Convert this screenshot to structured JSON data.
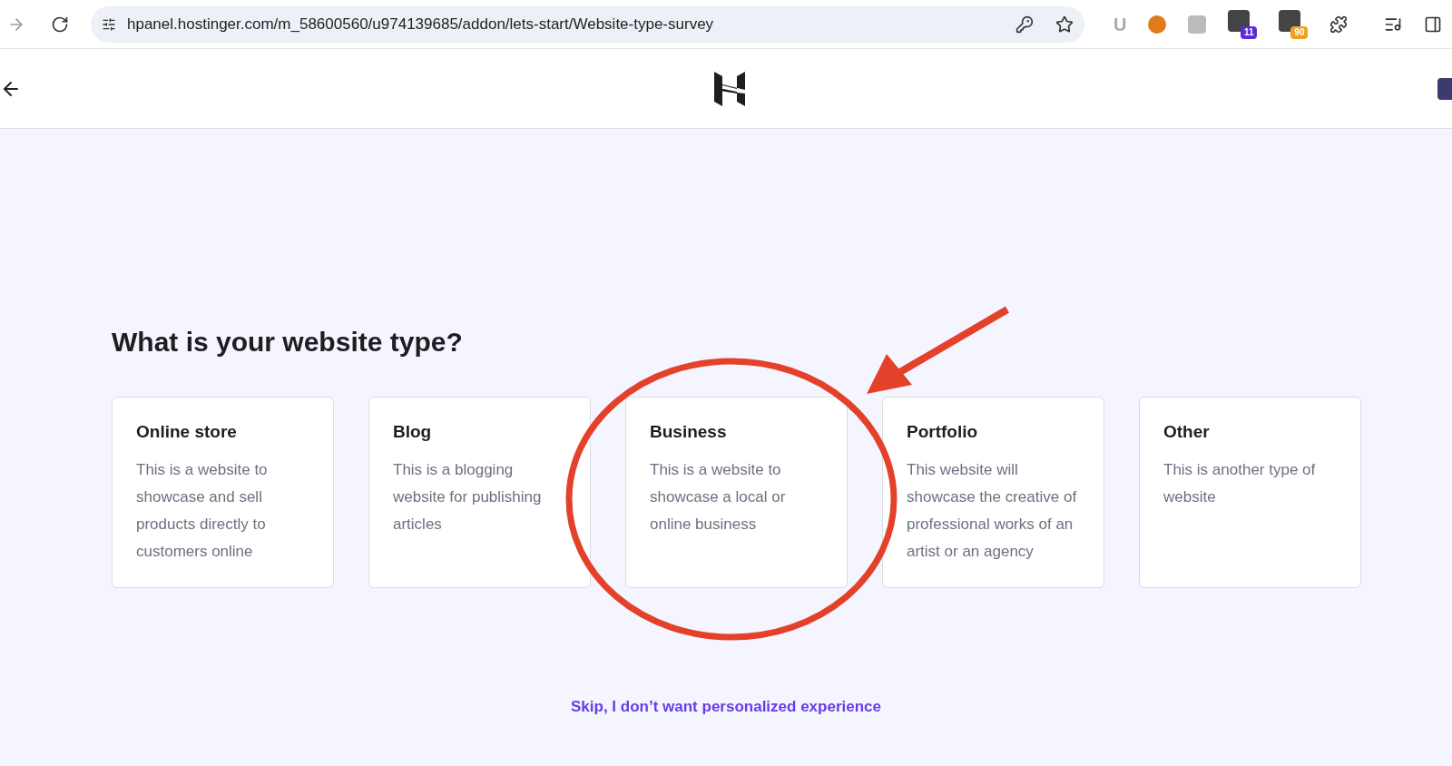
{
  "browser": {
    "url": "hpanel.hostinger.com/m_58600560/u974139685/addon/lets-start/Website-type-survey",
    "extensions": [
      {
        "kind": "letter",
        "label": "U"
      },
      {
        "kind": "plain"
      },
      {
        "kind": "plain"
      },
      {
        "kind": "badge",
        "badge": "11",
        "color": "#5b2bd6"
      },
      {
        "kind": "badge",
        "badge": "90",
        "color": "#f0a020"
      }
    ]
  },
  "page": {
    "heading": "What is your website type?",
    "options": [
      {
        "title": "Online store",
        "description": "This is a website to showcase and sell products directly to customers online"
      },
      {
        "title": "Blog",
        "description": "This is a blogging website for publishing articles"
      },
      {
        "title": "Business",
        "description": "This is a website to showcase a local or online business"
      },
      {
        "title": "Portfolio",
        "description": "This website will showcase the creative of professional works of an artist or an agency"
      },
      {
        "title": "Other",
        "description": "This is another type of website"
      }
    ],
    "skip_link": "Skip, I don’t want personalized experience"
  }
}
